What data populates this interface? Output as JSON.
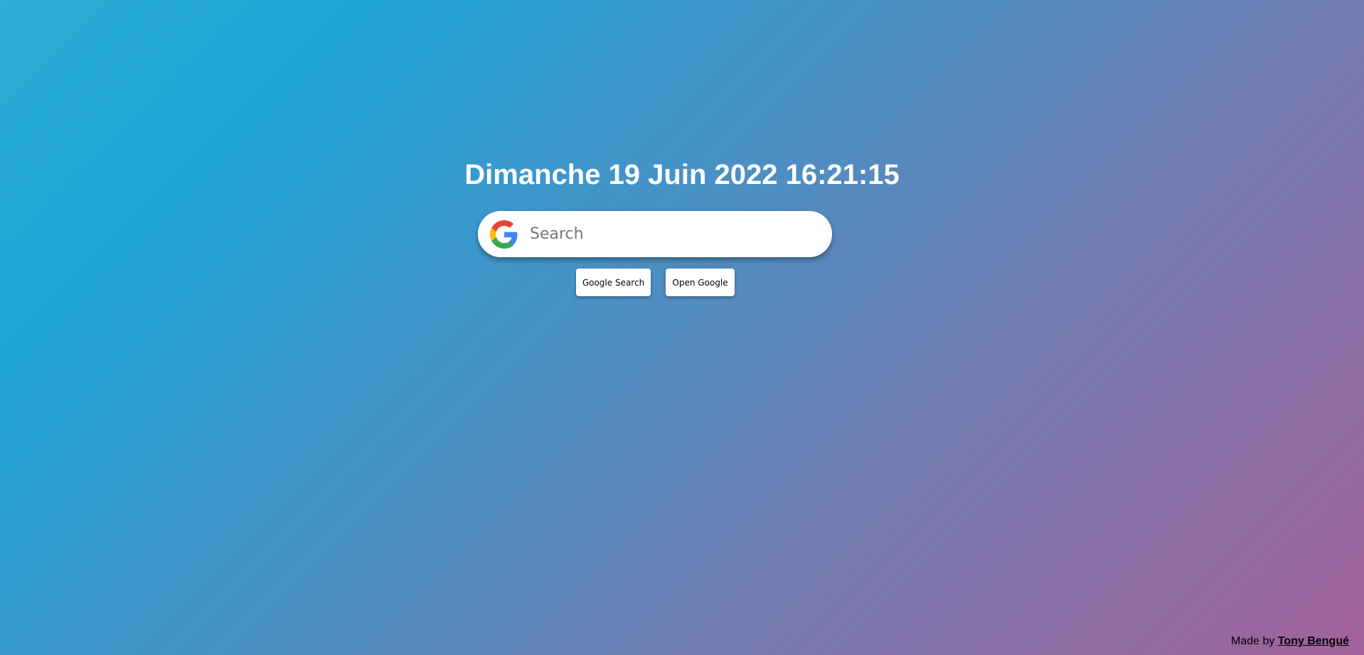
{
  "clock": {
    "datetime": "Dimanche 19 Juin 2022 16:21:15"
  },
  "search": {
    "placeholder": "Search",
    "value": "",
    "icon": "google-g-icon"
  },
  "buttons": {
    "google_search": "Google Search",
    "open_google": "Open Google"
  },
  "footer": {
    "prefix": "Made by",
    "author": "Tony Bengué"
  },
  "colors": {
    "gradient_start": "#2badd4",
    "gradient_end": "#a3619b"
  }
}
